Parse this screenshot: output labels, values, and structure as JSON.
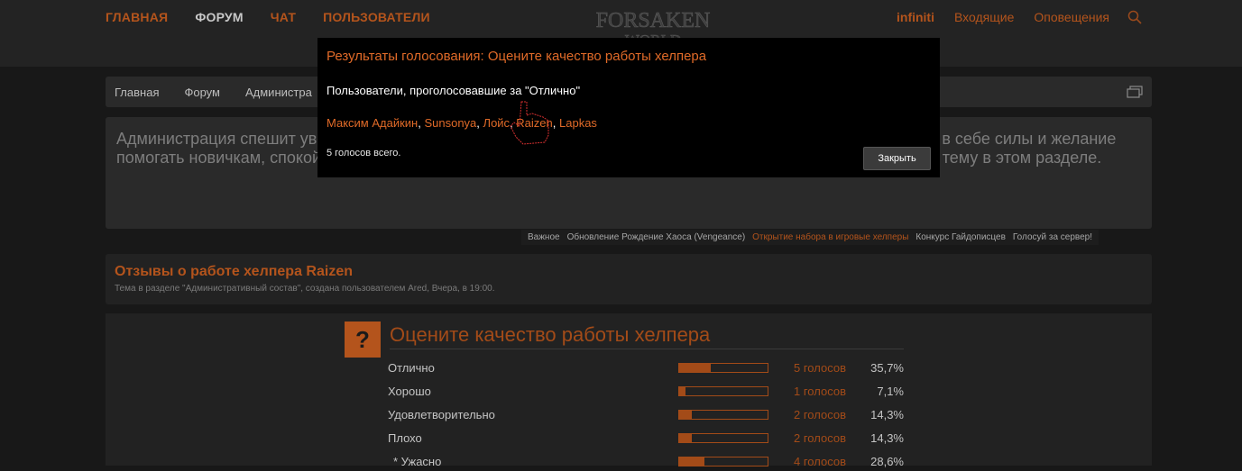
{
  "nav": {
    "items": [
      {
        "label": "ГЛАВНАЯ",
        "active": false
      },
      {
        "label": "ФОРУМ",
        "active": true
      },
      {
        "label": "ЧАТ",
        "active": false
      },
      {
        "label": "ПОЛЬЗОВАТЕЛИ",
        "active": false
      }
    ]
  },
  "logo": {
    "line1": "FORSAKEN",
    "line2": "WORLD"
  },
  "user_nav": {
    "username": "infiniti",
    "inbox": "Входящие",
    "alerts": "Оповещения"
  },
  "breadcrumbs": [
    "Главная",
    "Форум",
    "Администра"
  ],
  "notice": {
    "text": "Администрация спешит уведомить вас об открытии набора на должность игрового хелпера. Если вы видите в себе силы и желание помогать новичкам, спокойно и вежливо отвечать на их вопросы, то заполните анкету и создайте отдельную тему в этом разделе."
  },
  "notice_tabs": [
    {
      "label": "Важное",
      "active": false
    },
    {
      "label": "Обновление Рождение Хаоса (Vengeance)",
      "active": false
    },
    {
      "label": "Открытие набора в игровые хелперы",
      "active": true
    },
    {
      "label": "Конкурс Гайдописцев",
      "active": false
    },
    {
      "label": "Голосуй за сервер!",
      "active": false
    }
  ],
  "thread": {
    "title": "Отзывы о работе хелпера Raizen",
    "meta": "Тема в разделе \"Административный состав\", создана пользователем Ared, Вчера, в 19:00."
  },
  "poll": {
    "icon": "?",
    "question": "Оцените качество работы хелпера",
    "options": [
      {
        "label": "Отлично",
        "votes": "5 голосов",
        "percent": "35,7%",
        "fraction": 0.357
      },
      {
        "label": "Хорошо",
        "votes": "1 голосов",
        "percent": "7,1%",
        "fraction": 0.071
      },
      {
        "label": "Удовлетворительно",
        "votes": "2 голосов",
        "percent": "14,3%",
        "fraction": 0.143
      },
      {
        "label": "Плохо",
        "votes": "2 голосов",
        "percent": "14,3%",
        "fraction": 0.143
      },
      {
        "label": "* Ужасно",
        "votes": "4 голосов",
        "percent": "28,6%",
        "fraction": 0.286
      }
    ]
  },
  "modal": {
    "title": "Результаты голосования: Оцените качество работы хелпера",
    "subtitle": "Пользователи, проголосовавшие за \"Отлично\"",
    "users": [
      "Максим Адайкин",
      "Sunsonya",
      "Лойс",
      "Raizen",
      "Lapkas"
    ],
    "separator": ", ",
    "total": "5 голосов всего.",
    "close_label": "Закрыть"
  },
  "colors": {
    "accent": "#b4541c",
    "modal_link": "#e06a28",
    "background": "#181818",
    "panel": "#2a2a2a"
  }
}
